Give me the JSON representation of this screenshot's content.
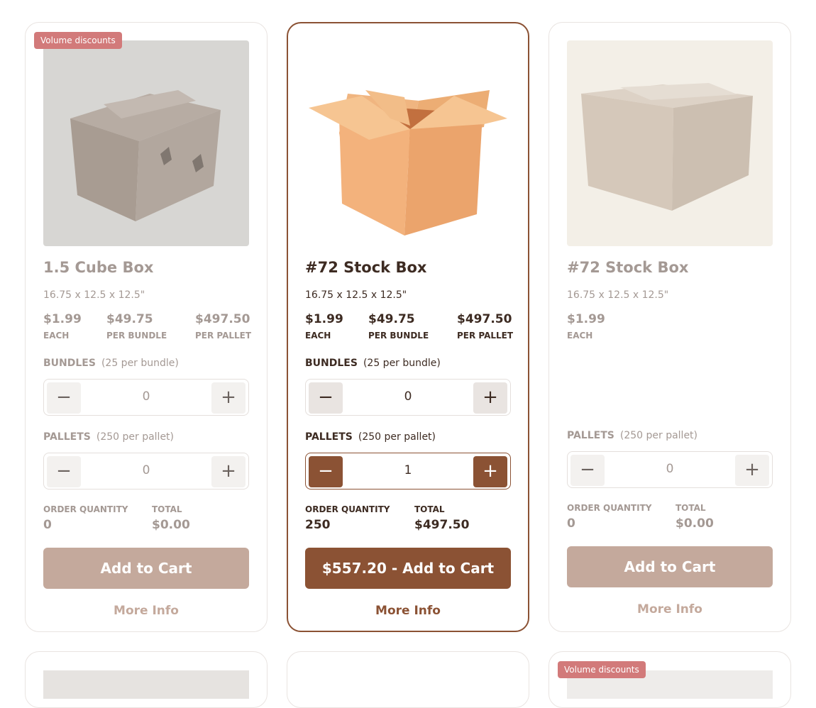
{
  "cards": [
    {
      "badge": "Volume discounts",
      "name": "1.5 Cube Box",
      "dims": "16.75 x 12.5 x 12.5\"",
      "prices": [
        {
          "value": "$1.99",
          "unit": "EACH"
        },
        {
          "value": "$49.75",
          "unit": "PER BUNDLE"
        },
        {
          "value": "$497.50",
          "unit": "PER PALLET"
        }
      ],
      "bundles": {
        "label": "BUNDLES",
        "note": "(25 per bundle)",
        "qty": "0"
      },
      "pallets": {
        "label": "PALLETS",
        "note": "(250 per pallet)",
        "qty": "0"
      },
      "order_qty_label": "ORDER QUANTITY",
      "order_qty": "0",
      "total_label": "TOTAL",
      "total": "$0.00",
      "cart_label": "Add to Cart",
      "more_label": "More Info",
      "image_icon": "closed-cardboard-box-icon"
    },
    {
      "name": "#72 Stock Box",
      "dims": "16.75 x 12.5 x 12.5\"",
      "prices": [
        {
          "value": "$1.99",
          "unit": "EACH"
        },
        {
          "value": "$49.75",
          "unit": "PER BUNDLE"
        },
        {
          "value": "$497.50",
          "unit": "PER PALLET"
        }
      ],
      "bundles": {
        "label": "BUNDLES",
        "note": "(25 per bundle)",
        "qty": "0"
      },
      "pallets": {
        "label": "PALLETS",
        "note": "(250 per pallet)",
        "qty": "1"
      },
      "order_qty_label": "ORDER QUANTITY",
      "order_qty": "250",
      "total_label": "TOTAL",
      "total": "$497.50",
      "cart_label": "$557.20 - Add to Cart",
      "more_label": "More Info",
      "image_icon": "open-cardboard-box-icon"
    },
    {
      "name": "#72 Stock Box",
      "dims": "16.75 x 12.5 x 12.5\"",
      "prices": [
        {
          "value": "$1.99",
          "unit": "EACH"
        }
      ],
      "pallets": {
        "label": "PALLETS",
        "note": "(250 per pallet)",
        "qty": "0"
      },
      "order_qty_label": "ORDER QUANTITY",
      "order_qty": "0",
      "total_label": "TOTAL",
      "total": "$0.00",
      "cart_label": "Add to Cart",
      "more_label": "More Info",
      "image_icon": "long-cardboard-box-icon"
    }
  ],
  "next_row": {
    "badge": "Volume discounts"
  },
  "colors": {
    "accent": "#8b5234",
    "accent_light": "#c4a99c",
    "badge": "#d27a7a"
  }
}
